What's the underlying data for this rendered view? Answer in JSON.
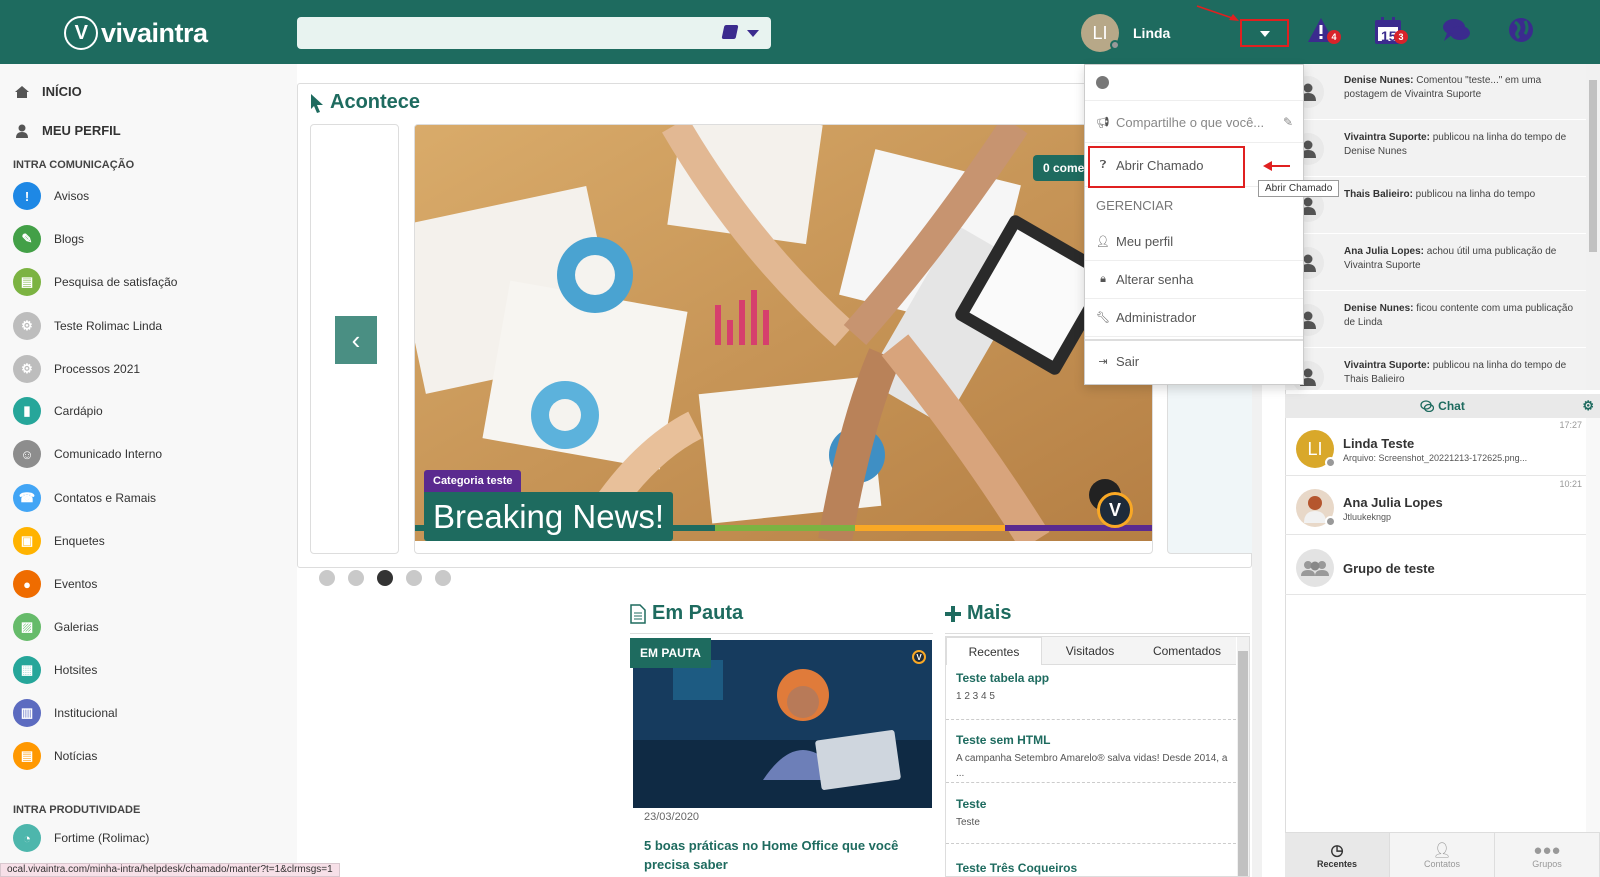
{
  "header": {
    "logo_text": "vivaintra",
    "user_initials": "LI",
    "user_name": "Linda",
    "alerts_badge": "4",
    "calendar_day": "15",
    "calendar_badge": "3"
  },
  "sidebar": {
    "nav": [
      {
        "label": "INÍCIO"
      },
      {
        "label": "MEU PERFIL"
      }
    ],
    "section_comunicacao": "INTRA COMUNICAÇÃO",
    "items": [
      {
        "label": "Avisos",
        "color": "#1e88e5",
        "glyph": "!"
      },
      {
        "label": "Blogs",
        "color": "#43a047",
        "glyph": "✎"
      },
      {
        "label": "Pesquisa de satisfação",
        "color": "#7cb342",
        "glyph": "▤"
      },
      {
        "label": "Teste Rolimac Linda",
        "color": "#bdbdbd",
        "glyph": "⚙"
      },
      {
        "label": "Processos 2021",
        "color": "#bdbdbd",
        "glyph": "⚙"
      },
      {
        "label": "Cardápio",
        "color": "#26a69a",
        "glyph": "▮"
      },
      {
        "label": "Comunicado Interno",
        "color": "#8d8d8d",
        "glyph": "☺"
      },
      {
        "label": "Contatos e Ramais",
        "color": "#42a5f5",
        "glyph": "☎"
      },
      {
        "label": "Enquetes",
        "color": "#ffb300",
        "glyph": "▣"
      },
      {
        "label": "Eventos",
        "color": "#ef6c00",
        "glyph": "●"
      },
      {
        "label": "Galerias",
        "color": "#66bb6a",
        "glyph": "▨"
      },
      {
        "label": "Hotsites",
        "color": "#26a69a",
        "glyph": "▦"
      },
      {
        "label": "Institucional",
        "color": "#5c6bc0",
        "glyph": "▥"
      },
      {
        "label": "Notícias",
        "color": "#ff9800",
        "glyph": "▤"
      }
    ],
    "section_produtividade": "INTRA PRODUTIVIDADE",
    "prod_items": [
      {
        "label": "Fortime (Rolimac)",
        "color": "#4db6ac",
        "glyph": "◔"
      }
    ]
  },
  "status_url": "ocal.vivaintra.com/minha-intra/helpdesk/chamado/manter?t=1&clrmsgs=1",
  "acontece": {
    "title": "Acontece",
    "comments_badge": "0 comer",
    "category": "Categoria teste",
    "headline": "Breaking News!",
    "dots_total": 5,
    "dot_active": 3
  },
  "em_pauta": {
    "title": "Em Pauta",
    "tag": "EM PAUTA",
    "date": "23/03/2020",
    "headline": "5 boas práticas no Home Office que você precisa saber"
  },
  "mais": {
    "title": "Mais",
    "tabs": [
      "Recentes",
      "Visitados",
      "Comentados"
    ],
    "active_tab": "Recentes",
    "items": [
      {
        "title": "Teste tabela app",
        "desc": "1 2 3 4 5"
      },
      {
        "title": "Teste sem HTML",
        "desc": "A campanha Setembro Amarelo® salva vidas! Desde 2014, a ..."
      },
      {
        "title": "Teste",
        "desc": "Teste"
      },
      {
        "title": "Teste Três Coqueiros",
        "desc": ""
      }
    ]
  },
  "dropdown": {
    "share_placeholder": "Compartilhe o que você...",
    "abrir_chamado": "Abrir Chamado",
    "section_gerenciar": "GERENCIAR",
    "meu_perfil": "Meu perfil",
    "alterar_senha": "Alterar senha",
    "administrador": "Administrador",
    "sair": "Sair",
    "tooltip": "Abrir Chamado"
  },
  "activity": [
    {
      "name": "Denise Nunes:",
      "text": " Comentou \"teste...\" em uma postagem de Vivaintra Suporte"
    },
    {
      "name": "Vivaintra Suporte:",
      "text": " publicou na linha do tempo de Denise Nunes"
    },
    {
      "name": "Thais Balieiro:",
      "text": " publicou na linha do tempo"
    },
    {
      "name": "Ana Julia Lopes:",
      "text": " achou útil uma publicação de Vivaintra Suporte"
    },
    {
      "name": "Denise Nunes:",
      "text": " ficou contente com uma publicação de Linda"
    },
    {
      "name": "Vivaintra Suporte:",
      "text": " publicou na linha do tempo de Thais Balieiro"
    }
  ],
  "chat": {
    "title": "Chat",
    "conversations": [
      {
        "initials": "LI",
        "name": "Linda Teste",
        "sub": "Arquivo: Screenshot_20221213-172625.png...",
        "time": "17:27"
      },
      {
        "initials": "",
        "name": "Ana Julia Lopes",
        "sub": "Jtluukekngp",
        "time": "10:21"
      },
      {
        "initials": "",
        "name": "Grupo de teste",
        "sub": "",
        "time": ""
      }
    ]
  },
  "bottom_tabs": [
    "Recentes",
    "Contatos",
    "Grupos"
  ]
}
